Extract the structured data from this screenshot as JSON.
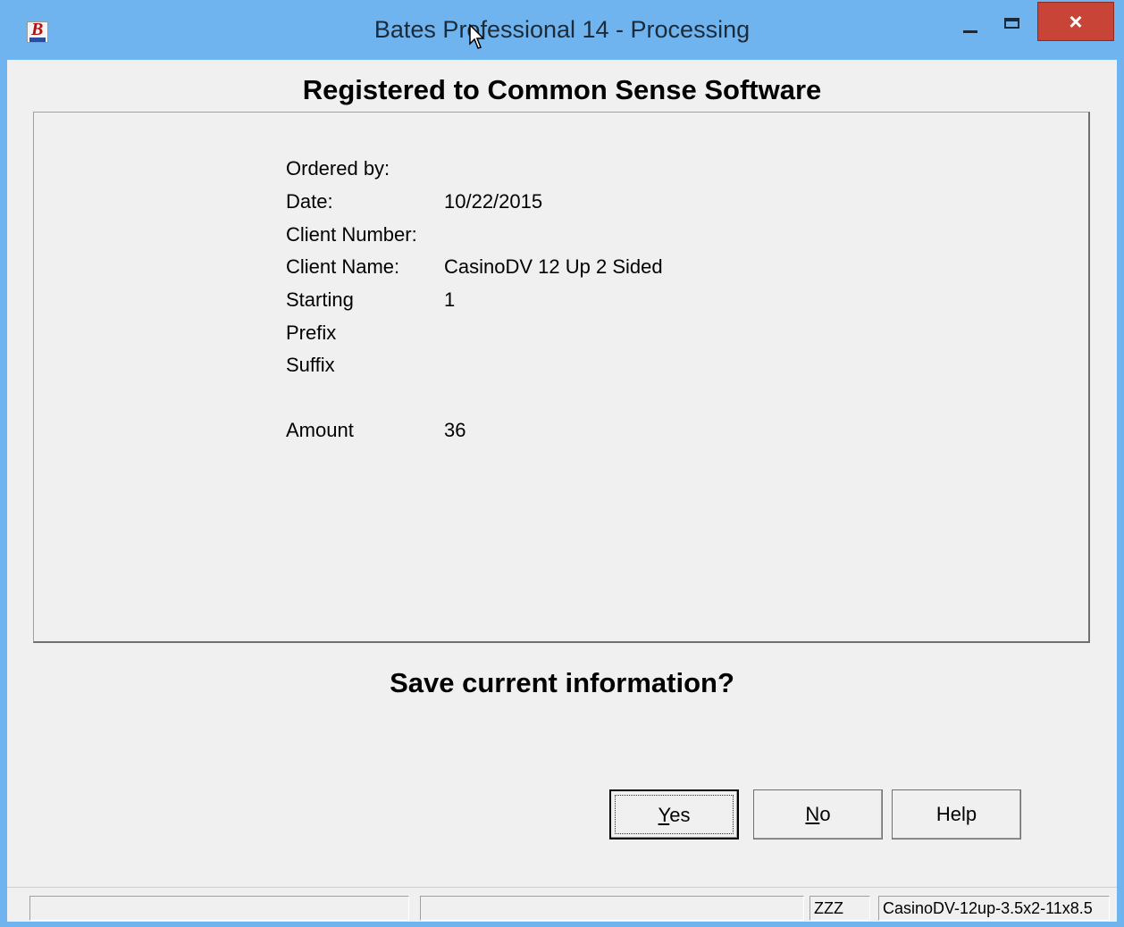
{
  "window": {
    "title": "Bates Professional 14 - Processing",
    "close_glyph": "×",
    "app_icon_letter": "B"
  },
  "header": {
    "registered": "Registered to Common Sense Software"
  },
  "details": {
    "ordered_by_label": "Ordered by:",
    "ordered_by_value": "",
    "date_label": "Date:",
    "date_value": "10/22/2015",
    "client_number_label": "Client Number:",
    "client_number_value": "",
    "client_name_label": "Client Name:",
    "client_name_value": "CasinoDV 12 Up 2 Sided",
    "starting_label": "Starting",
    "starting_value": "1",
    "prefix_label": "Prefix",
    "prefix_value": "",
    "suffix_label": "Suffix",
    "suffix_value": "",
    "amount_label": "Amount",
    "amount_value": "36"
  },
  "prompt": {
    "question": "Save current information?"
  },
  "buttons": {
    "yes_accel": "Y",
    "yes_rest": "es",
    "no_accel": "N",
    "no_rest": "o",
    "help": "Help"
  },
  "statusbar": {
    "pane1": "",
    "pane2": "",
    "pane3": "ZZZ",
    "pane4": "CasinoDV-12up-3.5x2-11x8.5"
  }
}
